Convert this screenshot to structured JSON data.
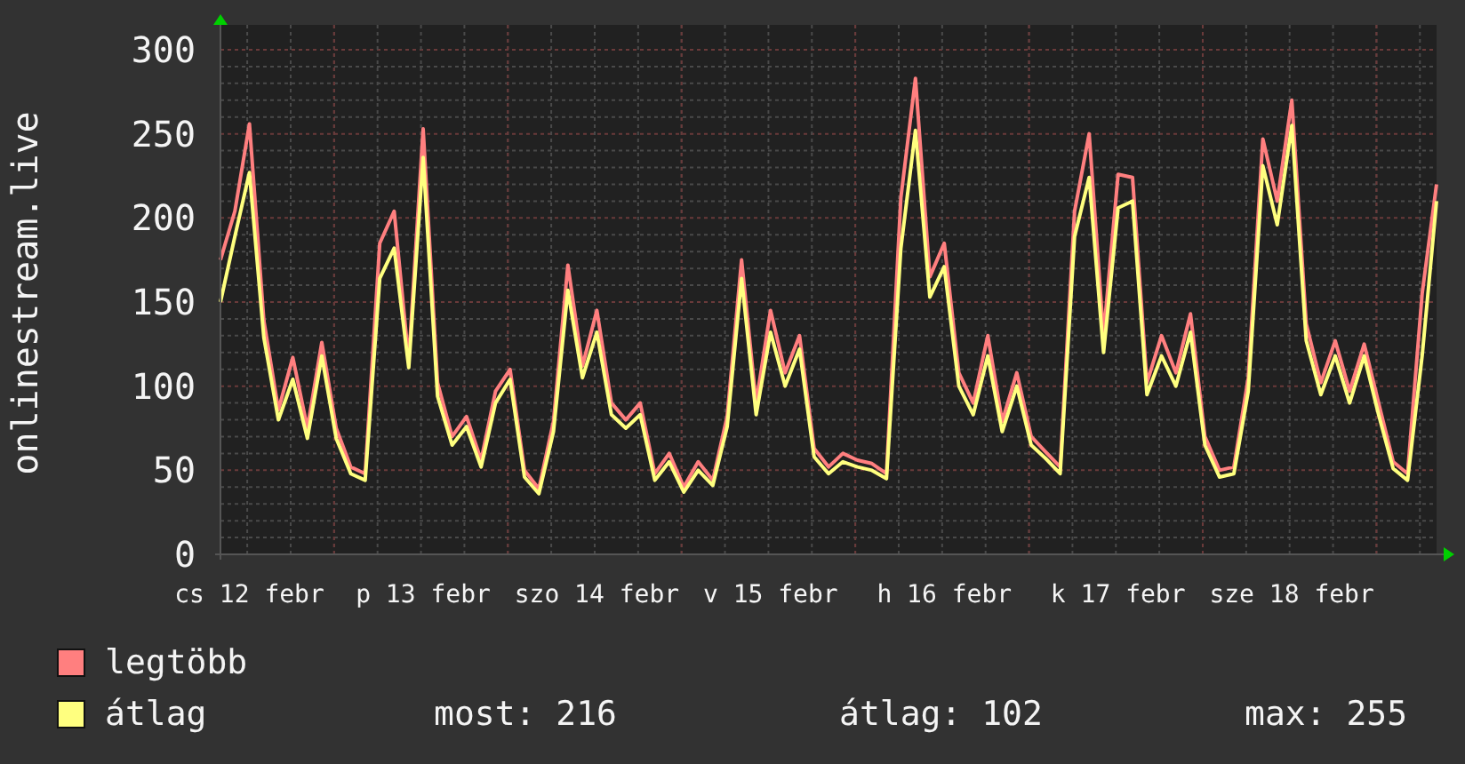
{
  "chart": {
    "chart_data": {
      "type": "line",
      "grid": true,
      "ylabel": "onlinestream.live",
      "ylim": [
        0,
        300
      ],
      "yticks": [
        0,
        50,
        100,
        150,
        200,
        250,
        300
      ],
      "categories": [
        null,
        null,
        "cs 12 febr",
        null,
        null,
        null,
        null,
        null,
        null,
        null,
        null,
        null,
        null,
        null,
        "p 13 febr",
        null,
        null,
        null,
        null,
        null,
        null,
        null,
        null,
        null,
        null,
        null,
        "szo 14 febr",
        null,
        null,
        null,
        null,
        null,
        null,
        null,
        null,
        null,
        null,
        null,
        "v 15 febr",
        null,
        null,
        null,
        null,
        null,
        null,
        null,
        null,
        null,
        null,
        null,
        "h 16 febr",
        null,
        null,
        null,
        null,
        null,
        null,
        null,
        null,
        null,
        null,
        null,
        "k 17 febr",
        null,
        null,
        null,
        null,
        null,
        null,
        null,
        null,
        null,
        null,
        null,
        "sze 18 febr",
        null,
        null,
        null,
        null,
        null,
        null,
        null,
        null,
        null,
        null
      ],
      "series": [
        {
          "name": "legtöbb",
          "color": "#ff7f7f",
          "values": [
            175,
            204,
            256,
            139,
            86,
            117,
            75,
            126,
            75,
            52,
            48,
            185,
            204,
            115,
            253,
            102,
            70,
            82,
            56,
            97,
            110,
            50,
            39,
            79,
            172,
            112,
            145,
            90,
            80,
            90,
            48,
            60,
            40,
            55,
            44,
            82,
            175,
            90,
            145,
            108,
            130,
            63,
            52,
            60,
            56,
            54,
            48,
            212,
            283,
            165,
            185,
            108,
            90,
            130,
            79,
            108,
            70,
            61,
            52,
            204,
            250,
            130,
            226,
            224,
            102,
            130,
            108,
            143,
            70,
            50,
            52,
            105,
            247,
            210,
            270,
            137,
            102,
            127,
            97,
            125,
            90,
            55,
            48,
            155,
            220
          ]
        },
        {
          "name": "átlag",
          "color": "#ffff7f",
          "values": [
            150,
            189,
            227,
            129,
            80,
            104,
            69,
            118,
            69,
            48,
            44,
            164,
            182,
            111,
            236,
            94,
            65,
            76,
            52,
            90,
            104,
            46,
            36,
            73,
            157,
            105,
            132,
            83,
            75,
            83,
            44,
            55,
            37,
            50,
            41,
            76,
            164,
            83,
            132,
            100,
            122,
            58,
            48,
            55,
            52,
            50,
            45,
            182,
            252,
            153,
            171,
            100,
            83,
            118,
            73,
            100,
            65,
            57,
            48,
            189,
            224,
            120,
            206,
            210,
            95,
            118,
            100,
            132,
            65,
            46,
            48,
            97,
            231,
            196,
            255,
            127,
            95,
            118,
            90,
            118,
            83,
            51,
            44,
            118,
            210
          ]
        }
      ]
    }
  },
  "legend_stats": [
    "most: 216",
    "átlag: 102",
    "max: 255"
  ]
}
